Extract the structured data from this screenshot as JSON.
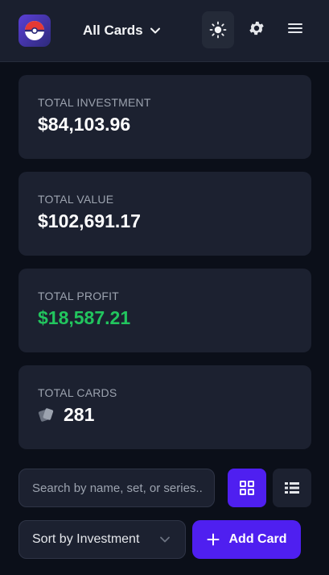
{
  "header": {
    "logo_icon": "pokeball-icon",
    "collection_label": "All Cards",
    "theme_icon": "sun-icon",
    "settings_icon": "gear-icon",
    "menu_icon": "hamburger-menu-icon"
  },
  "stats": {
    "investment": {
      "label": "TOTAL INVESTMENT",
      "value": "$84,103.96"
    },
    "value": {
      "label": "TOTAL VALUE",
      "value": "$102,691.17"
    },
    "profit": {
      "label": "TOTAL PROFIT",
      "value": "$18,587.21"
    },
    "cards": {
      "label": "TOTAL CARDS",
      "value": "281",
      "icon": "cards-icon"
    }
  },
  "toolbar": {
    "search_placeholder": "Search by name, set, or series...",
    "grid_view_icon": "grid-icon",
    "list_view_icon": "list-icon",
    "sort_label": "Sort by Investment",
    "add_label": "Add Card",
    "add_icon": "plus-icon"
  },
  "colors": {
    "accent": "#4f1ff0",
    "profit": "#22c55e",
    "background": "#0b0f19",
    "card": "#1c2130"
  }
}
